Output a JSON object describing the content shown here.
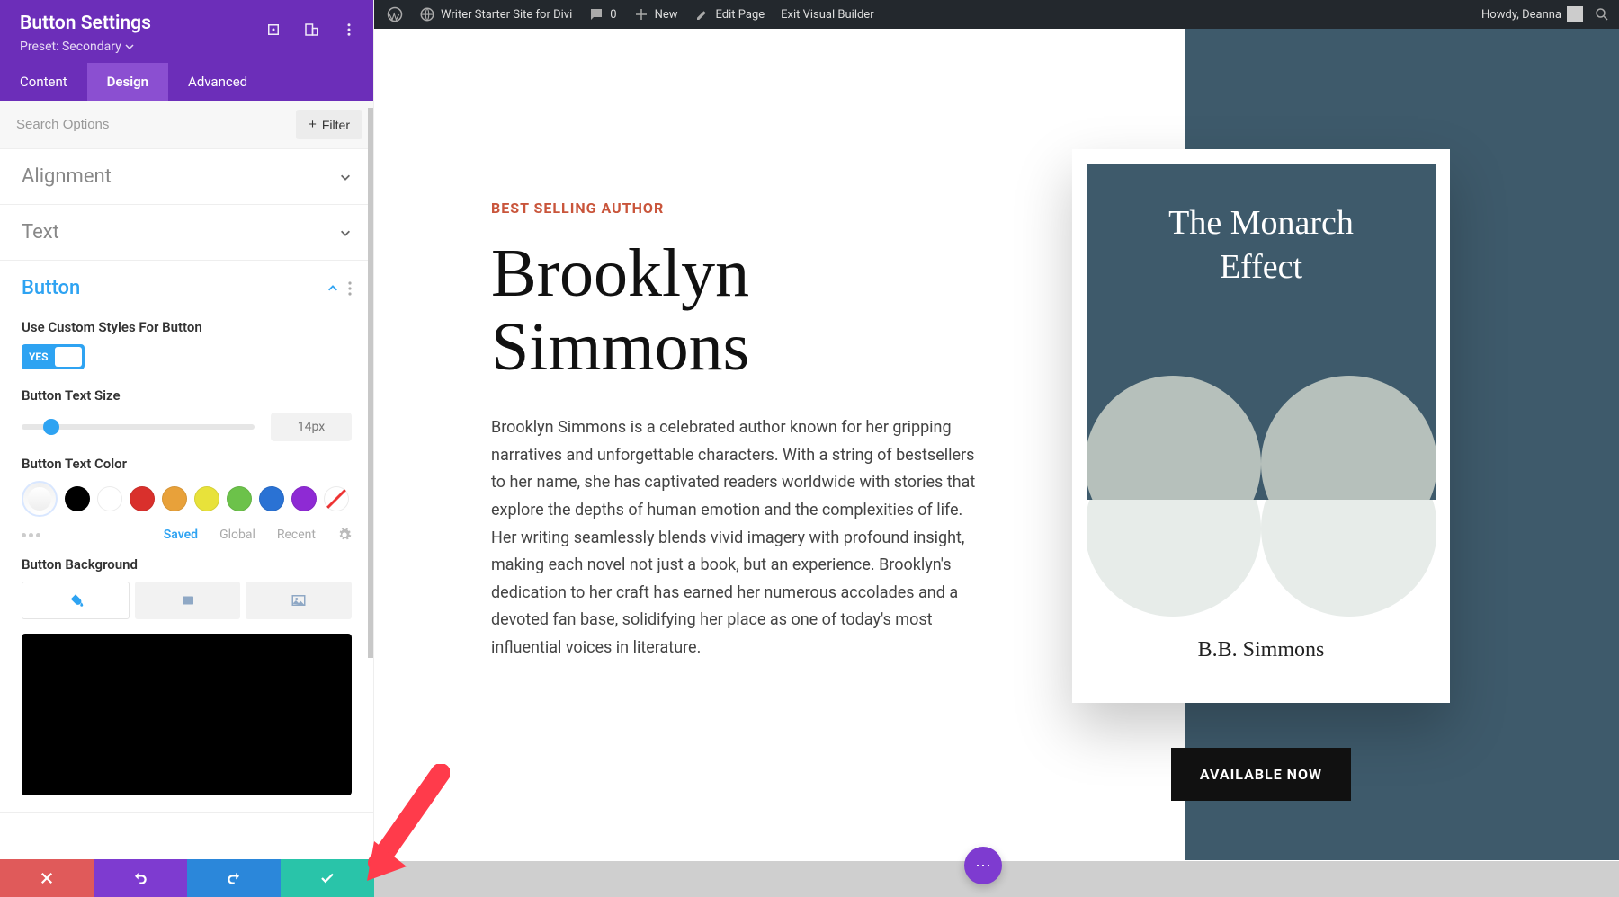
{
  "adminbar": {
    "site_name": "Writer Starter Site for Divi",
    "comments_count": "0",
    "new_label": "New",
    "edit_page": "Edit Page",
    "exit_vb": "Exit Visual Builder",
    "howdy": "Howdy, Deanna"
  },
  "panel": {
    "title": "Button Settings",
    "preset_label": "Preset: Secondary",
    "tabs": {
      "content": "Content",
      "design": "Design",
      "advanced": "Advanced"
    },
    "search_placeholder": "Search Options",
    "filter_label": "Filter"
  },
  "sections": {
    "alignment": "Alignment",
    "text": "Text",
    "button": "Button"
  },
  "button": {
    "use_custom_label": "Use Custom Styles For Button",
    "toggle_value": "YES",
    "text_size_label": "Button Text Size",
    "text_size_value": "14px",
    "text_color_label": "Button Text Color",
    "color_tabs": {
      "saved": "Saved",
      "global": "Global",
      "recent": "Recent"
    },
    "background_label": "Button Background",
    "swatches": [
      "#000000",
      "#ffffff",
      "#d9302c",
      "#e8a13a",
      "#e8e23a",
      "#6cc24a",
      "#2a72d4",
      "#8e2ad4"
    ]
  },
  "preview": {
    "eyebrow": "BEST SELLING AUTHOR",
    "hero_name": "Brooklyn Simmons",
    "hero_body": "Brooklyn Simmons is a celebrated author known for her gripping narratives and unforgettable characters. With a string of bestsellers to her name, she has captivated readers worldwide with stories that explore the depths of human emotion and the complexities of life. Her writing seamlessly blends vivid imagery with profound insight, making each novel not just a book, but an experience. Brooklyn's dedication to her craft has earned her numerous accolades and a devoted fan base, solidifying her place as one of today's most influential voices in literature.",
    "book_title_1": "The Monarch",
    "book_title_2": "Effect",
    "book_author": "B.B. Simmons",
    "cta": "AVAILABLE NOW"
  }
}
